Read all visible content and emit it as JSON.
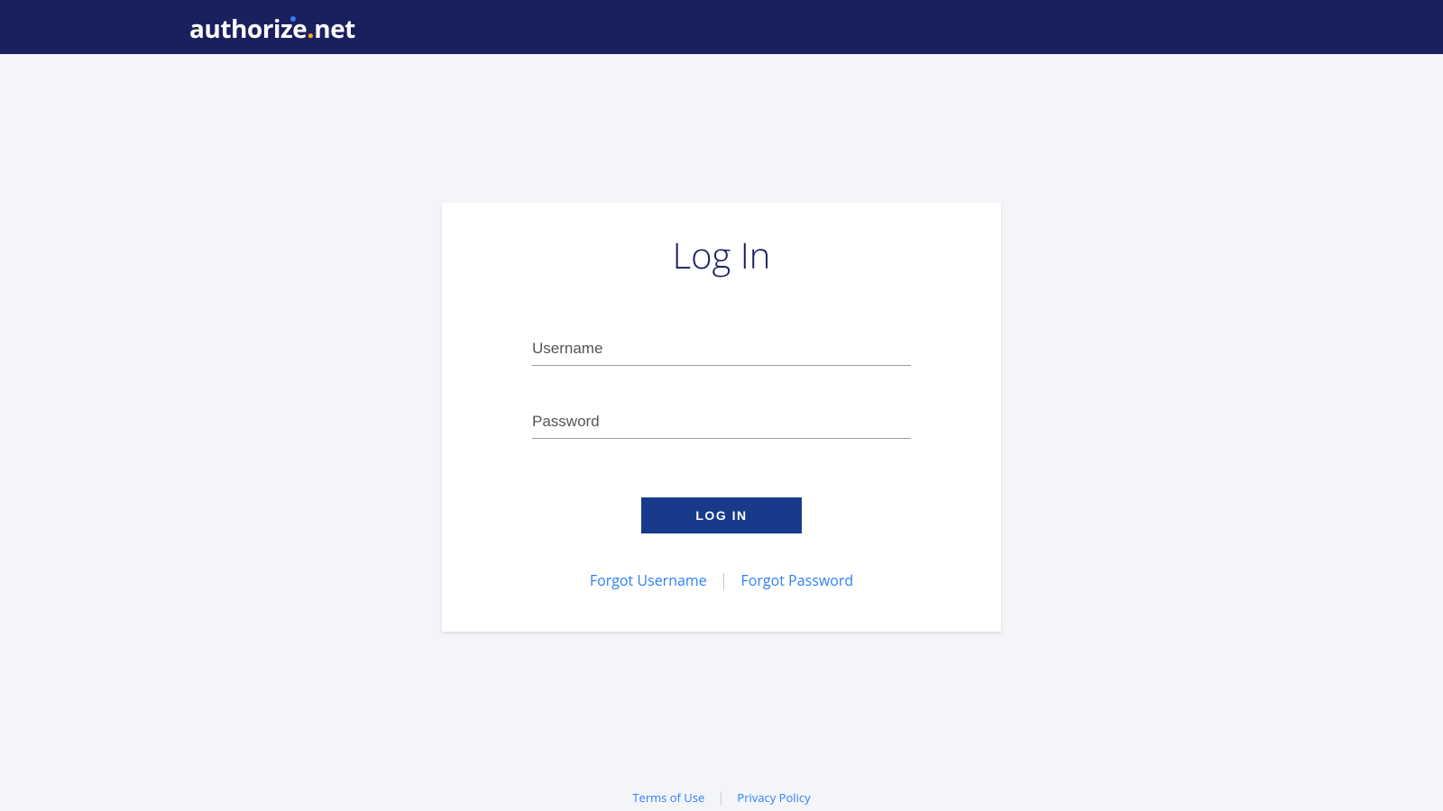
{
  "brand": {
    "name_part1": "author",
    "name_part2": "ze",
    "name_part3": "net"
  },
  "login": {
    "title": "Log In",
    "username_placeholder": "Username",
    "username_value": "",
    "password_placeholder": "Password",
    "password_value": "",
    "button_label": "LOG IN",
    "forgot_username_label": "Forgot Username",
    "forgot_password_label": "Forgot Password"
  },
  "footer": {
    "terms_label": "Terms of Use",
    "privacy_label": "Privacy Policy"
  }
}
